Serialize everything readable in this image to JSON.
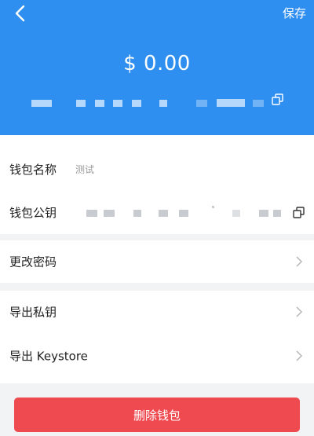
{
  "header": {
    "save_label": "保存",
    "balance": "$ 0.00"
  },
  "wallet": {
    "name_label": "钱包名称",
    "name_value": "测试",
    "public_key_label": "钱包公钥"
  },
  "menu": {
    "change_password": "更改密码",
    "export_private_key": "导出私钥",
    "export_keystore": "导出 Keystore"
  },
  "actions": {
    "delete_label": "删除钱包"
  },
  "colors": {
    "header_bg": "#2f8ff0",
    "delete_bg": "#ef4a50"
  },
  "icons": {
    "back": "back-arrow-icon",
    "copy": "copy-icon",
    "chevron": "chevron-right-icon"
  }
}
